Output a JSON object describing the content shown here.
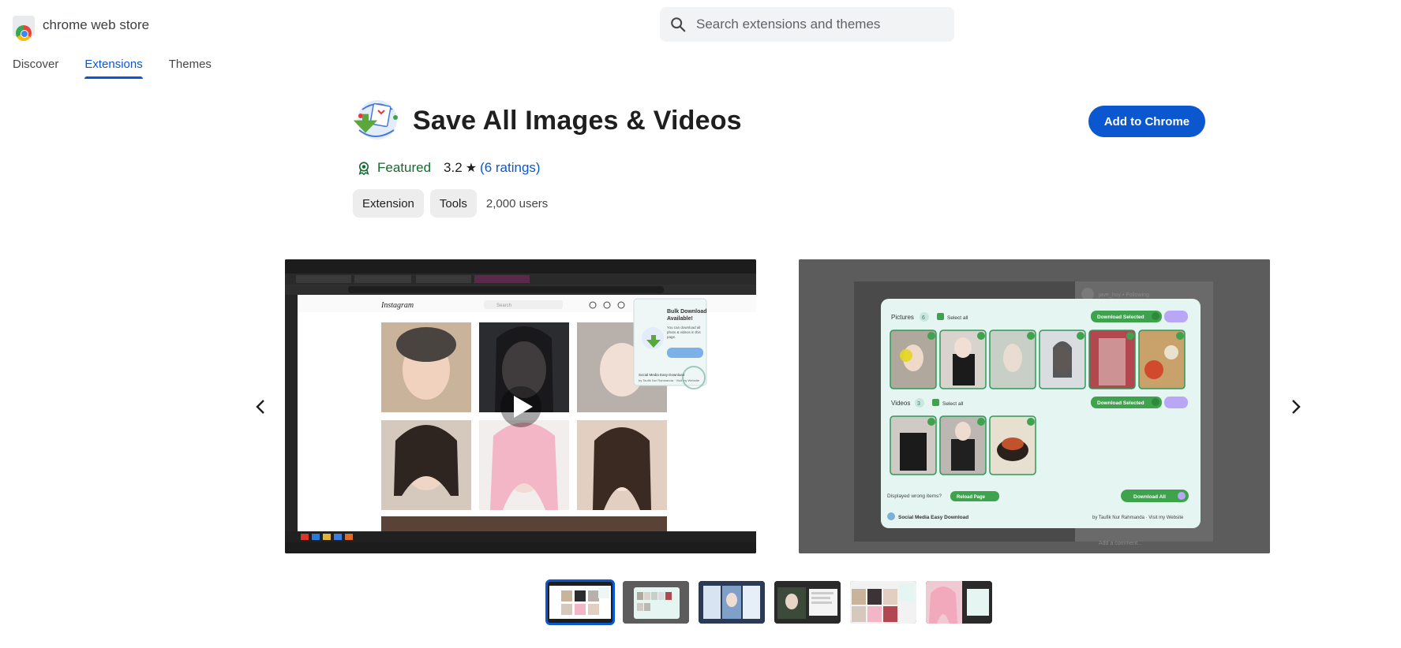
{
  "header": {
    "store_name": "chrome web store",
    "search_placeholder": "Search extensions and themes"
  },
  "nav": {
    "tabs": [
      {
        "label": "Discover",
        "active": false
      },
      {
        "label": "Extensions",
        "active": true
      },
      {
        "label": "Themes",
        "active": false
      }
    ]
  },
  "extension": {
    "title": "Save All Images & Videos",
    "add_button": "Add to Chrome",
    "featured": "Featured",
    "rating": "3.2",
    "star": "★",
    "ratings_link": "6 ratings",
    "chips": [
      "Extension",
      "Tools"
    ],
    "users": "2,000 users"
  },
  "screenshot1": {
    "site": "Instagram",
    "search": "Search",
    "popup_title": "Bulk Download Available!",
    "popup_text": "You can download all photo & videos in this page.",
    "popup_button": "Start Bulk Download",
    "popup_footer": "Social Media Easy Download",
    "popup_author": "by Taufik Nur Rahmanda · Visit my Website"
  },
  "screenshot2": {
    "pictures_label": "Pictures",
    "pictures_count": "6",
    "select_all": "Select all",
    "download_selected": "Download Selected",
    "pictures_selected": "6",
    "videos_label": "Videos",
    "videos_count": "3",
    "videos_selected": "3",
    "wrong_items": "Displayed wrong items?",
    "reload": "Reload Page",
    "download_all": "Download All",
    "download_all_count": "9",
    "footer_name": "Social Media Easy Download",
    "footer_author": "by Taufik Nur Rahmanda · Visit my Website",
    "bg_user": "jave_hoy • Following",
    "bg_comment": "Add a comment..."
  },
  "colors": {
    "accent": "#0b57d0",
    "featured_green": "#146c2e",
    "panel_teal": "#dff3ef",
    "download_green": "#3fa34d",
    "lilac": "#b9a7f5"
  },
  "thumbnails": [
    {
      "name": "thumb-1",
      "active": true
    },
    {
      "name": "thumb-2",
      "active": false
    },
    {
      "name": "thumb-3",
      "active": false
    },
    {
      "name": "thumb-4",
      "active": false
    },
    {
      "name": "thumb-5",
      "active": false
    },
    {
      "name": "thumb-6",
      "active": false
    }
  ]
}
